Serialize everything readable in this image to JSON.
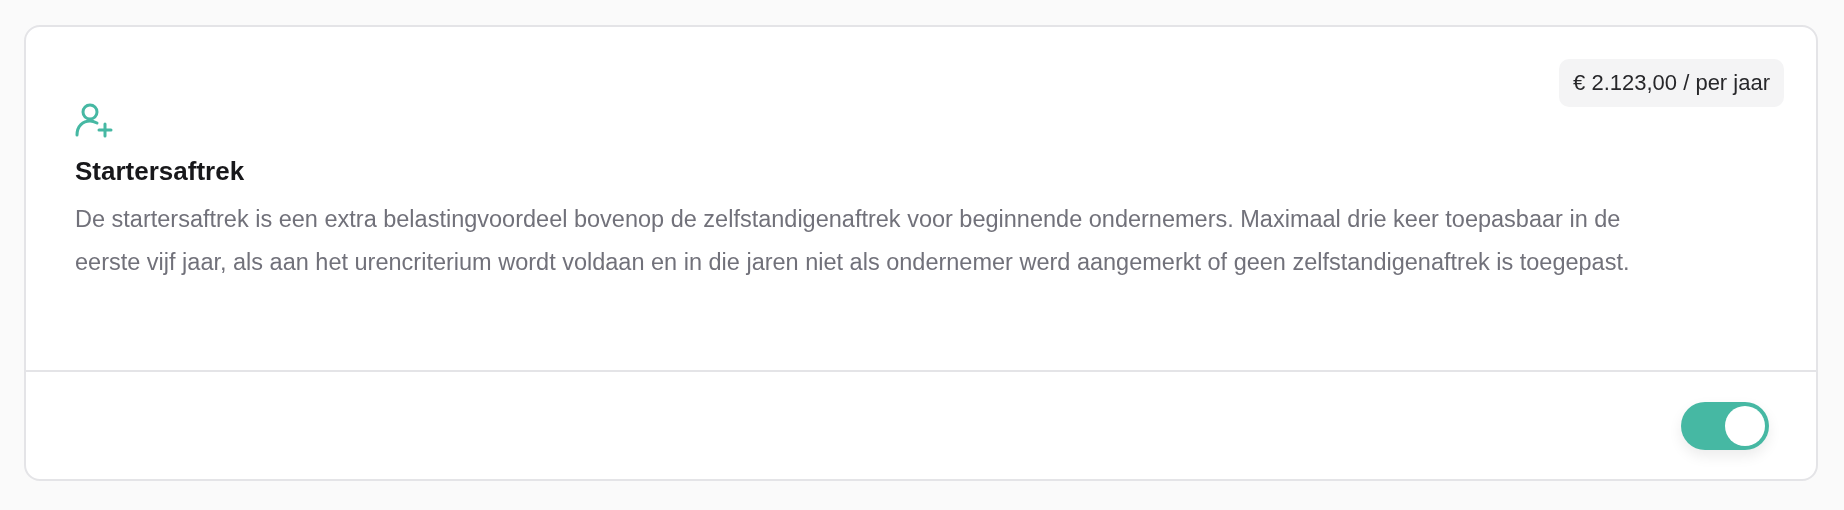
{
  "card": {
    "title": "Startersaftrek",
    "amount": "€ 2.123,00 / per jaar",
    "description": "De startersaftrek is een extra belastingvoordeel bovenop de zelfstandigenaftrek voor beginnende ondernemers. Maximaal drie keer toepasbaar in de eerste vijf jaar, als aan het urencriterium wordt voldaan en in die jaren niet als ondernemer werd aangemerkt of geen zelfstandigenaftrek is toegepast.",
    "toggle": {
      "on": true
    }
  }
}
